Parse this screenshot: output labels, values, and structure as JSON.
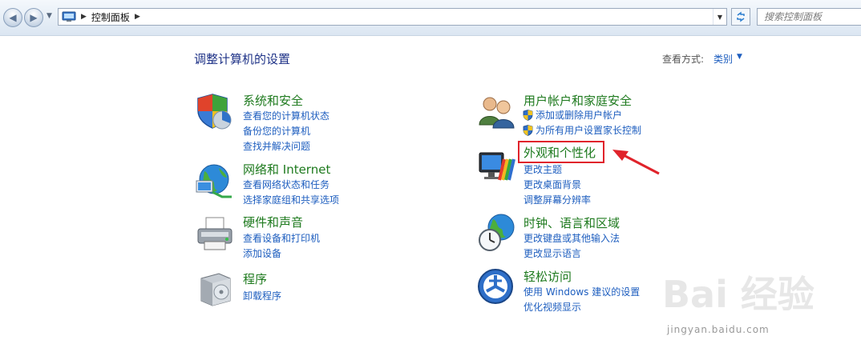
{
  "window": {
    "breadcrumb": "控制面板",
    "search_placeholder": "搜索控制面板"
  },
  "header": {
    "title": "调整计算机的设置",
    "view_label": "查看方式:",
    "view_value": "类别"
  },
  "categories": [
    {
      "title": "系统和安全",
      "icon": "security-shield-icon",
      "links": [
        "查看您的计算机状态",
        "备份您的计算机",
        "查找并解决问题"
      ]
    },
    {
      "title": "网络和 Internet",
      "icon": "network-globe-icon",
      "links": [
        "查看网络状态和任务",
        "选择家庭组和共享选项"
      ]
    },
    {
      "title": "硬件和声音",
      "icon": "printer-icon",
      "links": [
        "查看设备和打印机",
        "添加设备"
      ]
    },
    {
      "title": "程序",
      "icon": "programs-box-icon",
      "links": [
        "卸载程序"
      ]
    },
    {
      "title": "用户帐户和家庭安全",
      "icon": "users-icon",
      "links": [
        "添加或删除用户帐户",
        "为所有用户设置家长控制"
      ]
    },
    {
      "title": "外观和个性化",
      "icon": "monitor-palette-icon",
      "links": [
        "更改主题",
        "更改桌面背景",
        "调整屏幕分辨率"
      ]
    },
    {
      "title": "时钟、语言和区域",
      "icon": "clock-globe-icon",
      "links": [
        "更改键盘或其他输入法",
        "更改显示语言"
      ]
    },
    {
      "title": "轻松访问",
      "icon": "ease-of-access-icon",
      "links": [
        "使用 Windows 建议的设置",
        "优化视频显示"
      ]
    }
  ],
  "annotation": {
    "highlight_color": "#e0232b"
  },
  "watermark": {
    "logo": "Bai 经验",
    "url": "jingyan.baidu.com"
  }
}
